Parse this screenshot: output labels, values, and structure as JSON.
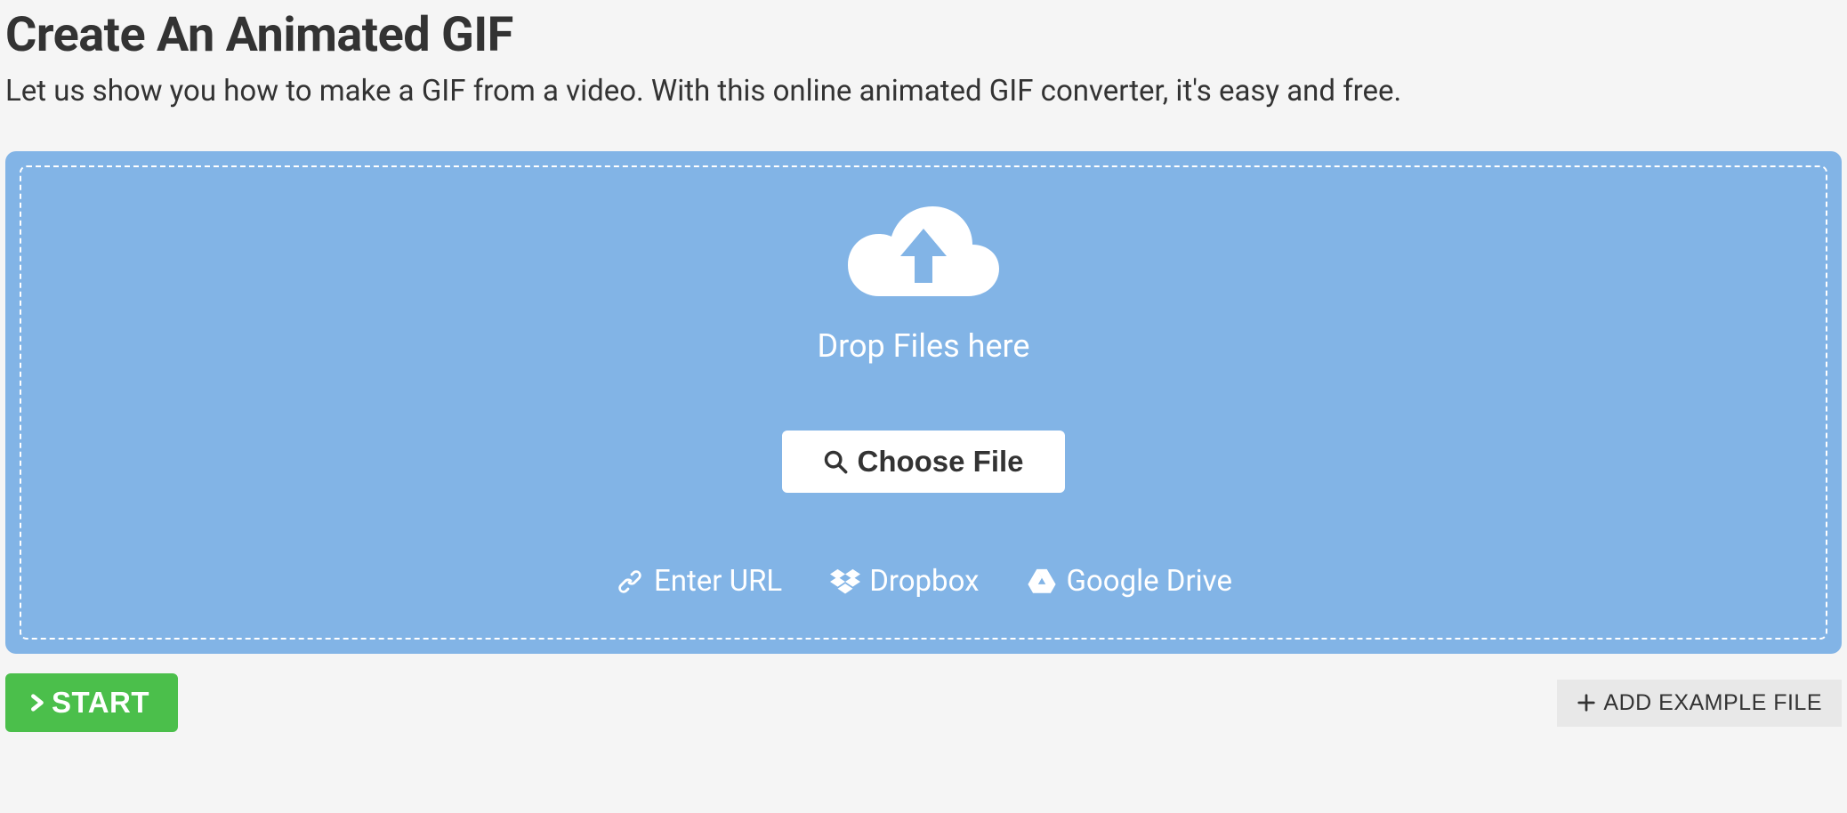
{
  "header": {
    "title": "Create An Animated GIF",
    "subtitle": "Let us show you how to make a GIF from a video. With this online animated GIF converter, it's easy and free."
  },
  "dropzone": {
    "drop_text": "Drop Files here",
    "choose_label": "Choose File",
    "sources": {
      "enter_url": "Enter URL",
      "dropbox": "Dropbox",
      "google_drive": "Google Drive"
    }
  },
  "footer": {
    "start_label": "START",
    "example_label": "ADD EXAMPLE FILE"
  }
}
